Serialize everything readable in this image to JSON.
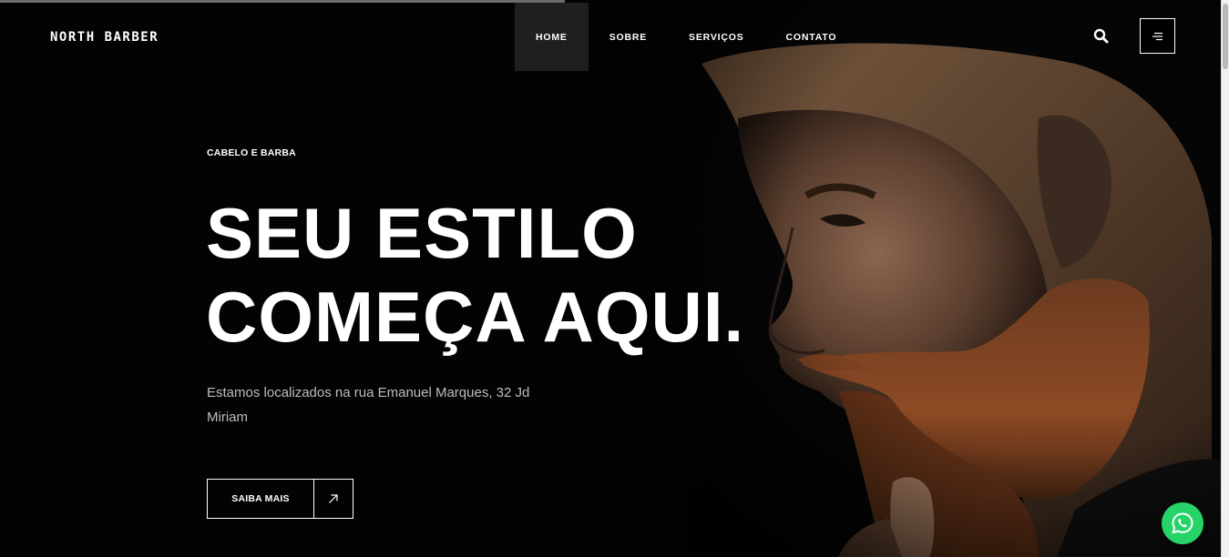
{
  "brand": {
    "name": "NORTH BARBER"
  },
  "nav": {
    "items": [
      {
        "label": "HOME",
        "active": true
      },
      {
        "label": "SOBRE",
        "active": false
      },
      {
        "label": "SERVIÇOS",
        "active": false
      },
      {
        "label": "CONTATO",
        "active": false
      }
    ],
    "search_icon": "search-icon",
    "menu_icon": "hamburger-icon"
  },
  "hero": {
    "eyebrow": "CABELO E BARBA",
    "headline_line1": "SEU ESTILO",
    "headline_line2": "COMEÇA AQUI.",
    "address": "Estamos localizados na rua Emanuel Marques, 32 Jd Miriam",
    "cta_label": "SAIBA MAIS",
    "cta_icon": "arrow-up-right-icon"
  },
  "floating": {
    "whatsapp_icon": "whatsapp-icon"
  },
  "colors": {
    "background": "#030303",
    "accent_whatsapp": "#25d366",
    "text": "#ffffff",
    "muted": "#bdbdbd"
  }
}
